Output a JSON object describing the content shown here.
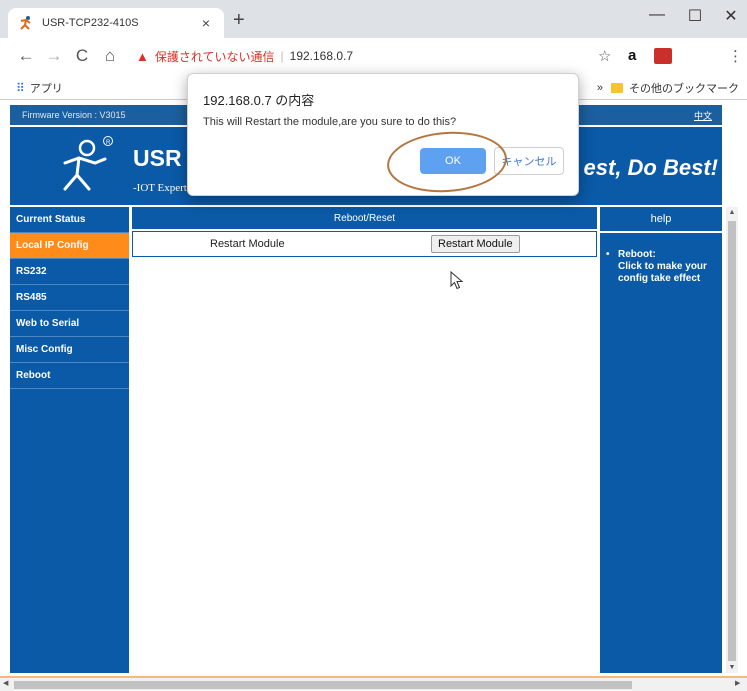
{
  "browser": {
    "tab_title": "USR-TCP232-410S",
    "tab_close": "×",
    "new_tab": "+",
    "window_minimize": "—",
    "window_maximize": "☐",
    "window_close": "✕",
    "nav_back": "←",
    "nav_forward": "→",
    "nav_reload": "C",
    "nav_home": "⌂",
    "security_warning": "保護されていない通信",
    "url_separator": "|",
    "url": "192.168.0.7",
    "star_icon": "☆",
    "ext_amazon": "a",
    "menu": "⋮",
    "bookmarks": {
      "apps_label": "アプリ",
      "more_chevron": "»",
      "other_bookmarks": "その他のブックマーク"
    }
  },
  "page": {
    "firmware_text": "Firmware Version : V3015",
    "language_link": "中文",
    "brand": "USR",
    "tagline_sub": "-IOT Experts-",
    "slogan": "est, Do Best!",
    "sidebar_items": [
      "Current Status",
      "Local IP Config",
      "RS232",
      "RS485",
      "Web to Serial",
      "Misc Config",
      "Reboot"
    ],
    "active_sidebar_index": 1,
    "main_header": "Reboot/Reset",
    "row_label": "Restart Module",
    "restart_button": "Restart Module",
    "help_header": "help",
    "help_bullet": "•",
    "help_title": "Reboot:",
    "help_text": "Click to make your config take effect"
  },
  "dialog": {
    "title": "192.168.0.7 の内容",
    "message": "This will Restart the module,are you sure to do this?",
    "ok_label": "OK",
    "cancel_label": "キャンセル"
  },
  "colors": {
    "brand_blue": "#0a5aa7",
    "active_orange": "#ff8c1a",
    "ok_blue": "#5ea1f0",
    "annotation_brown": "#b5753f",
    "warning_red": "#d93025"
  }
}
